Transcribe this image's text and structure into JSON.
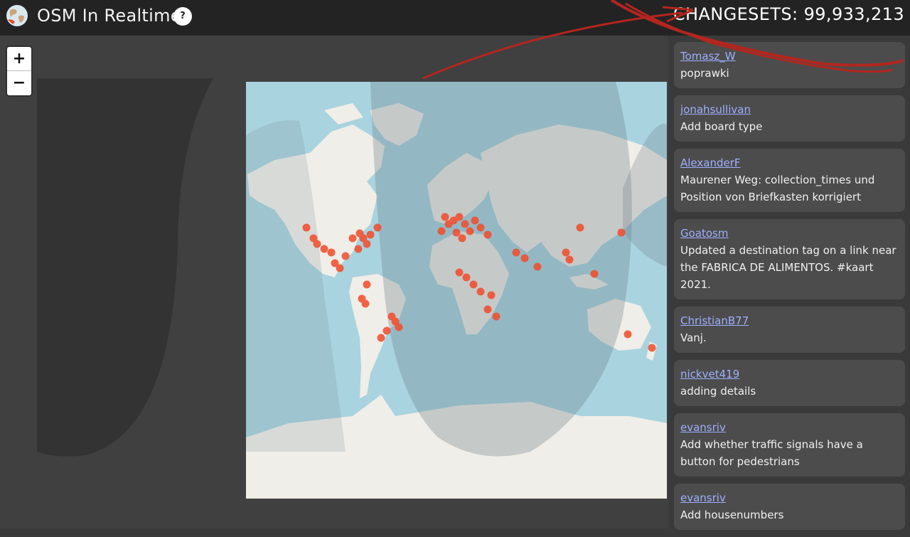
{
  "header": {
    "title": "OSM In Realtime",
    "help_icon": "?",
    "counter": "CHANGESETS: 99,933,213"
  },
  "map": {
    "zoom_in": "+",
    "zoom_out": "−",
    "colors": {
      "ocean": "#a9d3df",
      "land": "#f0eee8",
      "night": "#6a7f88",
      "marker": "#f24b2a"
    }
  },
  "feed": [
    {
      "user": "Tomasz_W",
      "message": "poprawki"
    },
    {
      "user": "jonahsullivan",
      "message": "Add board type"
    },
    {
      "user": "AlexanderF",
      "message": "Maurener Weg: collection_times und Position von Briefkasten korrigiert"
    },
    {
      "user": "Goatosm",
      "message": "Updated a destination tag on a link near the FABRICA DE ALIMENTOS. #kaart 2021."
    },
    {
      "user": "ChristianB77",
      "message": "Vanj."
    },
    {
      "user": "nickvet419",
      "message": "adding details"
    },
    {
      "user": "evansriv",
      "message": "Add whether traffic signals have a button for pedestrians"
    },
    {
      "user": "evansriv",
      "message": "Add housenumbers"
    }
  ]
}
